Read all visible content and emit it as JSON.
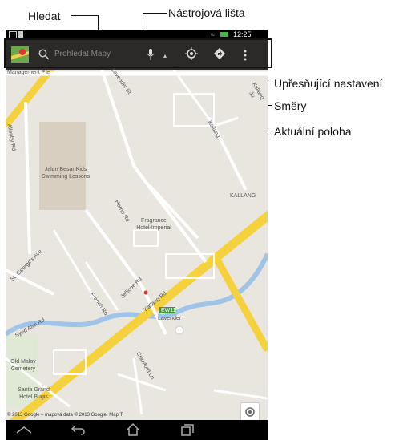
{
  "callouts": {
    "search": "Hledat",
    "toolbar": "Nástrojová lišta",
    "settings": "Upřesňující nastavení",
    "directions": "Směry",
    "location": "Aktuální poloha"
  },
  "statusbar": {
    "time": "12:25"
  },
  "toolbar": {
    "search_placeholder": "Prohledat Mapy"
  },
  "map": {
    "labels": {
      "management": "Management Pte",
      "school": "Jalan Besar Kids Swimming Lessons",
      "hotel": "Fragrance Hotel-Imperial",
      "horne": "Horne Rd",
      "french": "French Rd",
      "jellicoe": "Jellicoe Rd",
      "kallang_rd": "Kallang Rd",
      "kallang": "KALLANG",
      "kallang_ju": "Kallang Ju",
      "kallang2": "Kallang",
      "lavender": "Lavender",
      "ew11": "EW11",
      "cemetery": "Old Malay Cemetery",
      "santa": "Santa Grand Hotel Bugis",
      "crawford": "Crawford Ln",
      "sungei": "Syed Alwi Rd",
      "george": "St. George's Ave",
      "allenby": "Allenby Rd",
      "lavender_st": "Lavender St"
    },
    "copyright": "© 2013 Google – mapová data © 2013 Google, MapIT"
  },
  "colors": {
    "road": "#f5d13e",
    "park": "#d8cfc0",
    "water": "#9fc4e8",
    "map": "#e9e6df"
  }
}
